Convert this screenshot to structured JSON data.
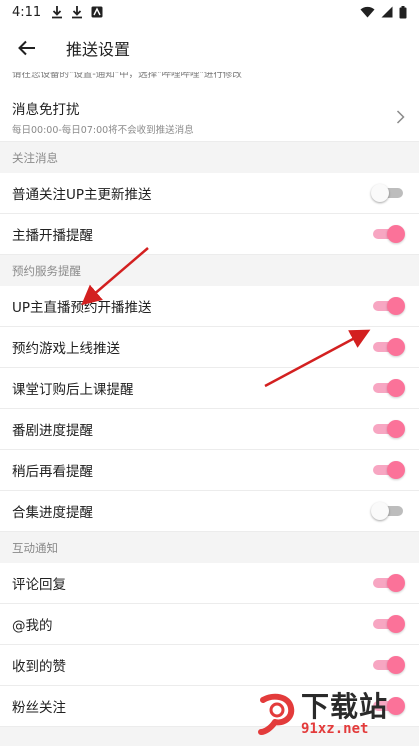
{
  "status_bar": {
    "time": "4:11"
  },
  "app_bar": {
    "title": "推送设置"
  },
  "hint_text": "请在您设备的\"设置-通知\"中，选择\"哔哩哔哩\"进行修改",
  "dnd": {
    "label": "消息免打扰",
    "sub": "每日00:00-每日07:00将不会收到推送消息"
  },
  "sections": {
    "follow": {
      "header": "关注消息",
      "items": [
        {
          "label": "普通关注UP主更新推送",
          "on": false
        },
        {
          "label": "主播开播提醒",
          "on": true
        }
      ]
    },
    "reserve": {
      "header": "预约服务提醒",
      "items": [
        {
          "label": "UP主直播预约开播推送",
          "on": true
        },
        {
          "label": "预约游戏上线推送",
          "on": true
        },
        {
          "label": "课堂订购后上课提醒",
          "on": true
        },
        {
          "label": "番剧进度提醒",
          "on": true
        },
        {
          "label": "稍后再看提醒",
          "on": true
        },
        {
          "label": "合集进度提醒",
          "on": false
        }
      ]
    },
    "interact": {
      "header": "互动通知",
      "items": [
        {
          "label": "评论回复",
          "on": true
        },
        {
          "label": "@我的",
          "on": true
        },
        {
          "label": "收到的赞",
          "on": true
        },
        {
          "label": "粉丝关注",
          "on": true
        }
      ]
    }
  },
  "watermark": {
    "main": "下载站",
    "sub": "91xz.net"
  },
  "colors": {
    "accent": "#fb7299",
    "accent_track": "#f7a6c2",
    "arrow": "#d32020"
  }
}
